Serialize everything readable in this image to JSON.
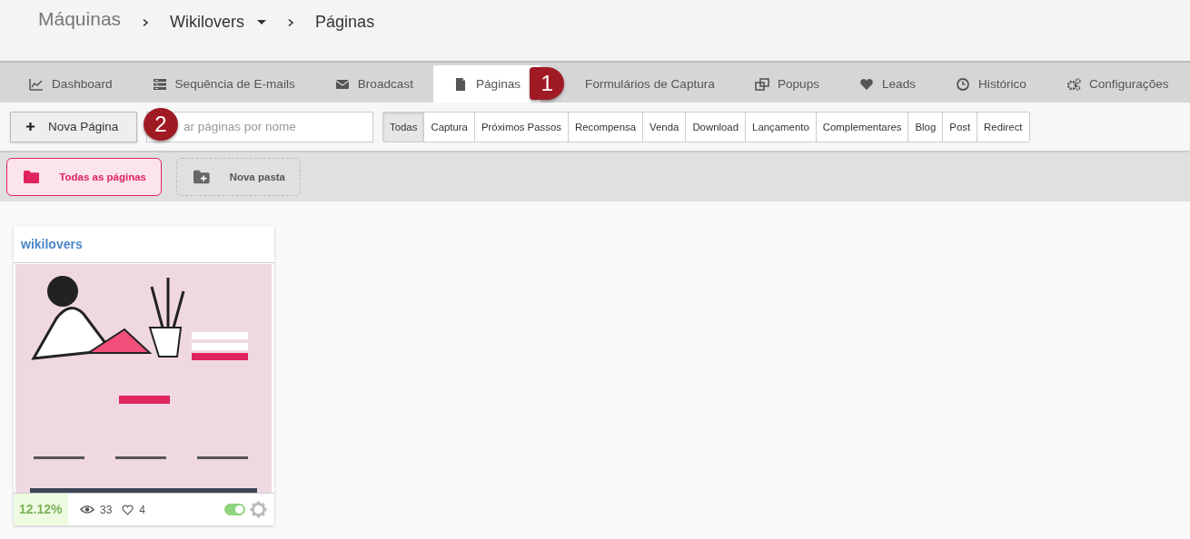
{
  "breadcrumb": [
    {
      "label": "Máquinas",
      "kind": "root"
    },
    {
      "label": "Wikilovers",
      "kind": "dropdown"
    },
    {
      "label": "Páginas",
      "kind": "current"
    }
  ],
  "tabs": [
    {
      "label": "Dashboard",
      "selected": false
    },
    {
      "label": "Sequência de E-mails",
      "selected": false
    },
    {
      "label": "Broadcast",
      "selected": false
    },
    {
      "label": "Páginas",
      "selected": true
    },
    {
      "label": "Formulários de Captura",
      "selected": false
    },
    {
      "label": "Popups",
      "selected": false
    },
    {
      "label": "Leads",
      "selected": false
    },
    {
      "label": "Histórico",
      "selected": false
    },
    {
      "label": "Configurações",
      "selected": false
    }
  ],
  "new_page_button": "Nova Página",
  "search": {
    "placeholder": "ar páginas por nome"
  },
  "filters": [
    {
      "label": "Todas",
      "selected": true
    },
    {
      "label": "Captura",
      "selected": false
    },
    {
      "label": "Próximos Passos",
      "selected": false
    },
    {
      "label": "Recompensa",
      "selected": false
    },
    {
      "label": "Venda",
      "selected": false
    },
    {
      "label": "Download",
      "selected": false
    },
    {
      "label": "Lançamento",
      "selected": false
    },
    {
      "label": "Complementares",
      "selected": false
    },
    {
      "label": "Blog",
      "selected": false
    },
    {
      "label": "Post",
      "selected": false
    },
    {
      "label": "Redirect",
      "selected": false
    }
  ],
  "folders": [
    {
      "label": "Todas as páginas",
      "kind": "folder",
      "selected": true
    },
    {
      "label": "Nova pasta",
      "kind": "new",
      "selected": false
    }
  ],
  "pages": [
    {
      "title": "wikilovers",
      "conversion": "12.12%",
      "views": "33",
      "likes": "4",
      "enabled": true
    }
  ],
  "annotations": [
    {
      "number": "1"
    },
    {
      "number": "2"
    }
  ]
}
